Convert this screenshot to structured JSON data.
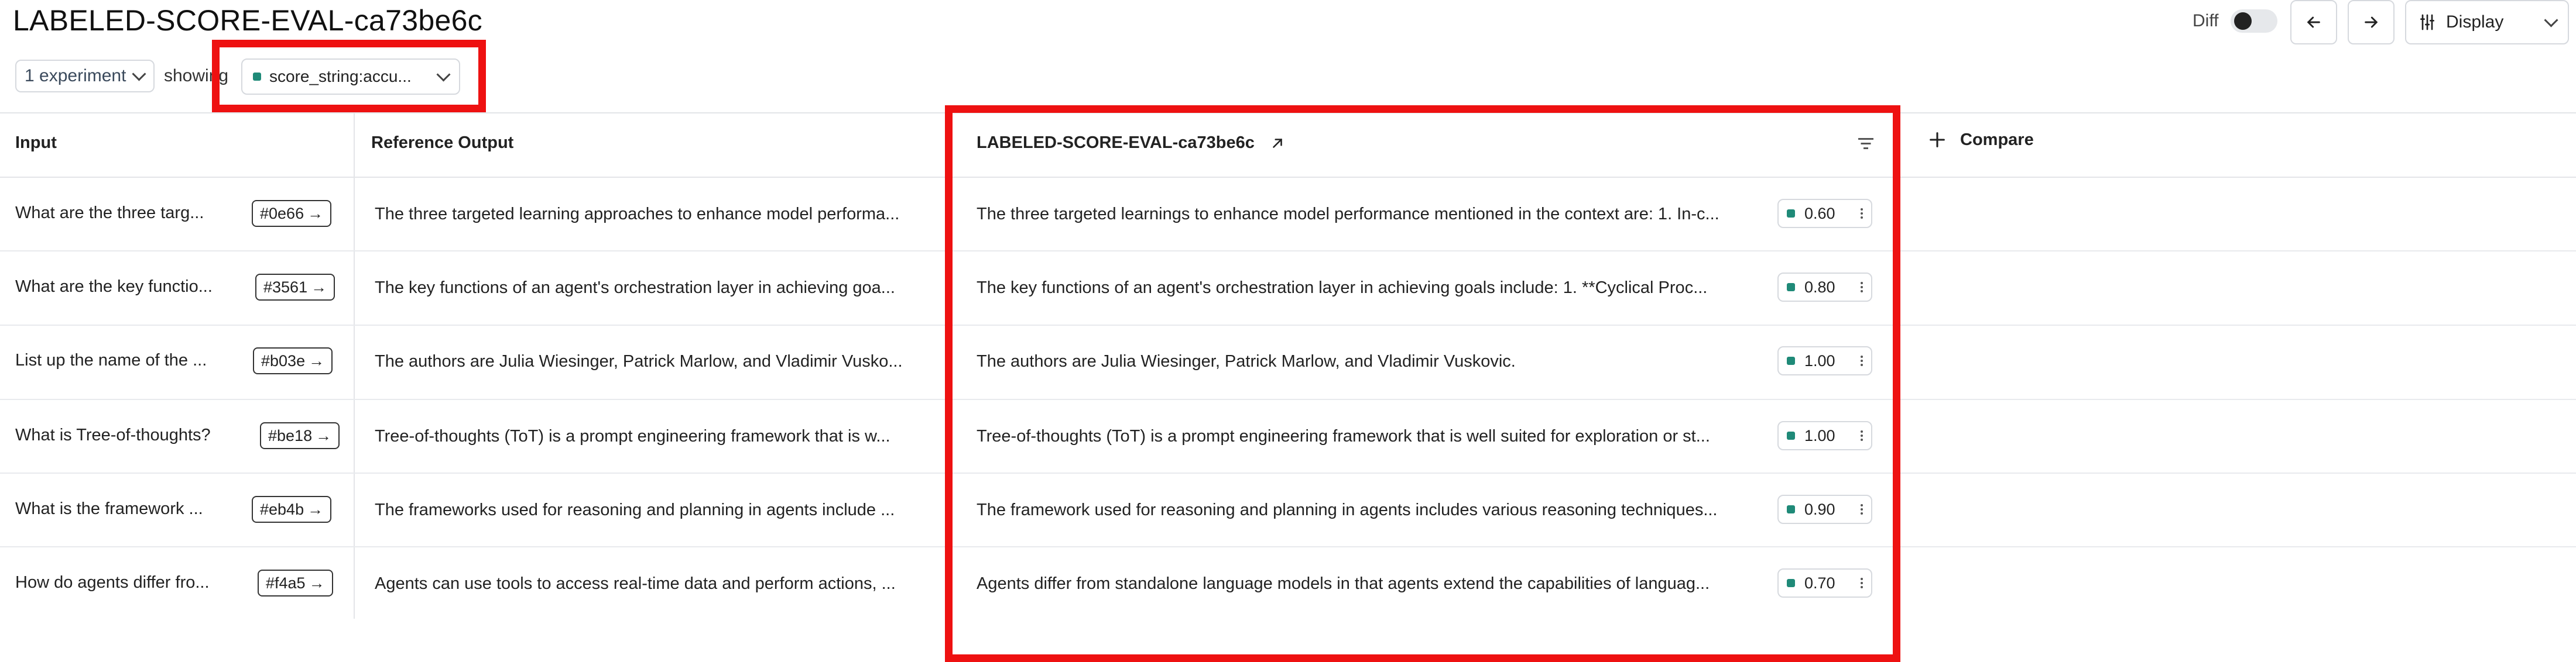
{
  "header": {
    "title": "LABELED-SCORE-EVAL-ca73be6c",
    "experiment_select": "1 experiment",
    "showing_label": "showing",
    "score_select": "score_string:accu...",
    "diff_label": "Diff",
    "display_label": "Display"
  },
  "table": {
    "columns": {
      "input": "Input",
      "reference": "Reference Output",
      "experiment": "LABELED-SCORE-EVAL-ca73be6c",
      "compare": "Compare"
    },
    "rows": [
      {
        "input": "What are the three targ...",
        "id": "#0e66",
        "reference": "The three targeted learning approaches to enhance model performa...",
        "output": "The three targeted learnings to enhance model performance mentioned in the context are: 1. In-c...",
        "score": "0.60"
      },
      {
        "input": "What are the key functio...",
        "id": "#3561",
        "reference": "The key functions of an agent's orchestration layer in achieving goa...",
        "output": "The key functions of an agent's orchestration layer in achieving goals include: 1. **Cyclical Proc...",
        "score": "0.80"
      },
      {
        "input": "List up the name of the ...",
        "id": "#b03e",
        "reference": "The authors are Julia Wiesinger, Patrick Marlow, and Vladimir Vusko...",
        "output": "The authors are Julia Wiesinger, Patrick Marlow, and Vladimir Vuskovic.",
        "score": "1.00"
      },
      {
        "input": "What is Tree-of-thoughts?",
        "id": "#be18",
        "reference": "Tree-of-thoughts (ToT) is a prompt engineering framework that is w...",
        "output": "Tree-of-thoughts (ToT) is a prompt engineering framework that is well suited for exploration or st...",
        "score": "1.00"
      },
      {
        "input": "What is the framework ...",
        "id": "#eb4b",
        "reference": "The frameworks used for reasoning and planning in agents include ...",
        "output": "The framework used for reasoning and planning in agents includes various reasoning techniques...",
        "score": "0.90"
      },
      {
        "input": "How do agents differ fro...",
        "id": "#f4a5",
        "reference": "Agents can use tools to access real-time data and perform actions, ...",
        "output": "Agents differ from standalone language models in that agents extend the capabilities of languag...",
        "score": "0.70"
      }
    ]
  },
  "colors": {
    "highlight": "#ee1111",
    "score_swatch": "#1f8a78"
  },
  "icons": [
    "chevron-down-icon",
    "arrow-left-icon",
    "arrow-right-icon",
    "sliders-icon",
    "external-link-icon",
    "filter-icon",
    "plus-icon",
    "arrow-right-small-icon",
    "kebab-menu-icon"
  ]
}
